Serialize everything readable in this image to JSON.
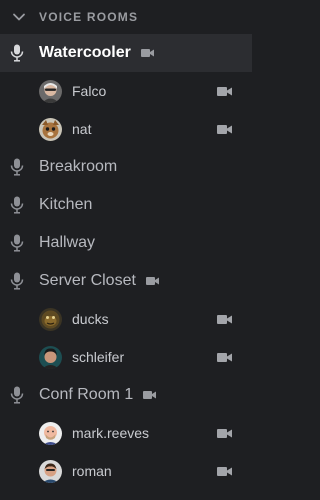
{
  "section": {
    "title": "VOICE ROOMS",
    "expanded": true
  },
  "channels": [
    {
      "name": "Watercooler",
      "active": true,
      "video": true,
      "users": [
        {
          "name": "Falco",
          "video": true
        },
        {
          "name": "nat",
          "video": true
        }
      ]
    },
    {
      "name": "Breakroom",
      "active": false,
      "video": false,
      "users": []
    },
    {
      "name": "Kitchen",
      "active": false,
      "video": false,
      "users": []
    },
    {
      "name": "Hallway",
      "active": false,
      "video": false,
      "users": []
    },
    {
      "name": "Server Closet",
      "active": false,
      "video": true,
      "users": [
        {
          "name": "ducks",
          "video": true
        },
        {
          "name": "schleifer",
          "video": true
        }
      ]
    },
    {
      "name": "Conf Room 1",
      "active": false,
      "video": true,
      "users": [
        {
          "name": "mark.reeves",
          "video": true
        },
        {
          "name": "roman",
          "video": true
        }
      ]
    }
  ],
  "colors": {
    "background": "#1e1f22",
    "active_row": "#2c2d31",
    "icon": "#8e9096",
    "header_text": "#9a9ca1"
  },
  "icons": {
    "section_toggle": "chevron-down-icon",
    "channel": "microphone-icon",
    "video": "video-camera-icon"
  }
}
